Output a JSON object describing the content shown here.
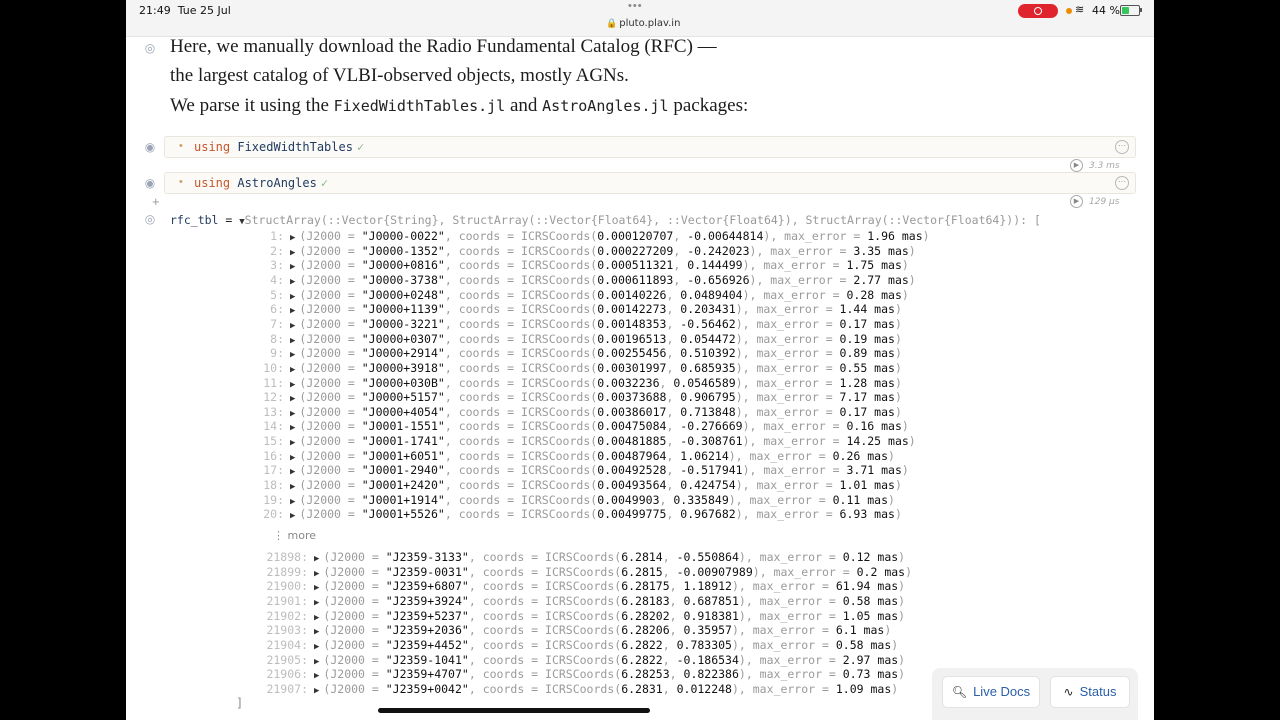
{
  "status_bar": {
    "time": "21:49",
    "date": "Tue 25 Jul",
    "url": "pluto.plav.in",
    "battery": "44 %",
    "battery_level": 0.44
  },
  "markdown": {
    "line1": "Here, we manually download the Radio Fundamental Catalog (RFC) —",
    "line2": "the largest catalog of VLBI-observed objects, mostly AGNs.",
    "line3_pre": "We parse it using the ",
    "pkg1": "FixedWidthTables.jl",
    "line3_mid": " and ",
    "pkg2": "AstroAngles.jl",
    "line3_post": " packages:"
  },
  "cells": [
    {
      "keyword": "using",
      "module": "FixedWidthTables",
      "runtime": "3.3 ms"
    },
    {
      "keyword": "using",
      "module": "AstroAngles",
      "runtime": "129 µs"
    }
  ],
  "output": {
    "varname": "rfc_tbl",
    "eq": " = ",
    "type": "StructArray(::Vector{String}, StructArray(::Vector{Float64}, ::Vector{Float64}), StructArray(::Vector{Float64})): [",
    "more_label": "more",
    "close": "]",
    "rows_top": [
      {
        "i": "1:",
        "name": "J0000-0022",
        "ra": "0.000120707",
        "dec": "-0.00644814",
        "err": "1.96"
      },
      {
        "i": "2:",
        "name": "J0000-1352",
        "ra": "0.000227209",
        "dec": "-0.242023",
        "err": "3.35"
      },
      {
        "i": "3:",
        "name": "J0000+0816",
        "ra": "0.000511321",
        "dec": "0.144499",
        "err": "1.75"
      },
      {
        "i": "4:",
        "name": "J0000-3738",
        "ra": "0.000611893",
        "dec": "-0.656926",
        "err": "2.77"
      },
      {
        "i": "5:",
        "name": "J0000+0248",
        "ra": "0.00140226",
        "dec": "0.0489404",
        "err": "0.28"
      },
      {
        "i": "6:",
        "name": "J0000+1139",
        "ra": "0.00142273",
        "dec": "0.203431",
        "err": "1.44"
      },
      {
        "i": "7:",
        "name": "J0000-3221",
        "ra": "0.00148353",
        "dec": "-0.56462",
        "err": "0.17"
      },
      {
        "i": "8:",
        "name": "J0000+0307",
        "ra": "0.00196513",
        "dec": "0.054472",
        "err": "0.19"
      },
      {
        "i": "9:",
        "name": "J0000+2914",
        "ra": "0.00255456",
        "dec": "0.510392",
        "err": "0.89"
      },
      {
        "i": "10:",
        "name": "J0000+3918",
        "ra": "0.00301997",
        "dec": "0.685935",
        "err": "0.55"
      },
      {
        "i": "11:",
        "name": "J0000+030B",
        "ra": "0.0032236",
        "dec": "0.0546589",
        "err": "1.28"
      },
      {
        "i": "12:",
        "name": "J0000+5157",
        "ra": "0.00373688",
        "dec": "0.906795",
        "err": "7.17"
      },
      {
        "i": "13:",
        "name": "J0000+4054",
        "ra": "0.00386017",
        "dec": "0.713848",
        "err": "0.17"
      },
      {
        "i": "14:",
        "name": "J0001-1551",
        "ra": "0.00475084",
        "dec": "-0.276669",
        "err": "0.16"
      },
      {
        "i": "15:",
        "name": "J0001-1741",
        "ra": "0.00481885",
        "dec": "-0.308761",
        "err": "14.25"
      },
      {
        "i": "16:",
        "name": "J0001+6051",
        "ra": "0.00487964",
        "dec": "1.06214",
        "err": "0.26"
      },
      {
        "i": "17:",
        "name": "J0001-2940",
        "ra": "0.00492528",
        "dec": "-0.517941",
        "err": "3.71"
      },
      {
        "i": "18:",
        "name": "J0001+2420",
        "ra": "0.00493564",
        "dec": "0.424754",
        "err": "1.01"
      },
      {
        "i": "19:",
        "name": "J0001+1914",
        "ra": "0.0049903",
        "dec": "0.335849",
        "err": "0.11"
      },
      {
        "i": "20:",
        "name": "J0001+5526",
        "ra": "0.00499775",
        "dec": "0.967682",
        "err": "6.93"
      }
    ],
    "rows_bottom": [
      {
        "i": "21898:",
        "name": "J2359-3133",
        "ra": "6.2814",
        "dec": "-0.550864",
        "err": "0.12"
      },
      {
        "i": "21899:",
        "name": "J2359-0031",
        "ra": "6.2815",
        "dec": "-0.00907989",
        "err": "0.2"
      },
      {
        "i": "21900:",
        "name": "J2359+6807",
        "ra": "6.28175",
        "dec": "1.18912",
        "err": "61.94"
      },
      {
        "i": "21901:",
        "name": "J2359+3924",
        "ra": "6.28183",
        "dec": "0.687851",
        "err": "0.58"
      },
      {
        "i": "21902:",
        "name": "J2359+5237",
        "ra": "6.28202",
        "dec": "0.918381",
        "err": "1.05"
      },
      {
        "i": "21903:",
        "name": "J2359+2036",
        "ra": "6.28206",
        "dec": "0.35957",
        "err": "6.1"
      },
      {
        "i": "21904:",
        "name": "J2359+4452",
        "ra": "6.2822",
        "dec": "0.783305",
        "err": "0.58"
      },
      {
        "i": "21905:",
        "name": "J2359-1041",
        "ra": "6.2822",
        "dec": "-0.186534",
        "err": "2.97"
      },
      {
        "i": "21906:",
        "name": "J2359+4707",
        "ra": "6.28253",
        "dec": "0.822386",
        "err": "0.73"
      },
      {
        "i": "21907:",
        "name": "J2359+0042",
        "ra": "6.2831",
        "dec": "0.012248",
        "err": "1.09"
      }
    ]
  },
  "buttons": {
    "live_docs": "Live Docs",
    "status": "Status"
  }
}
